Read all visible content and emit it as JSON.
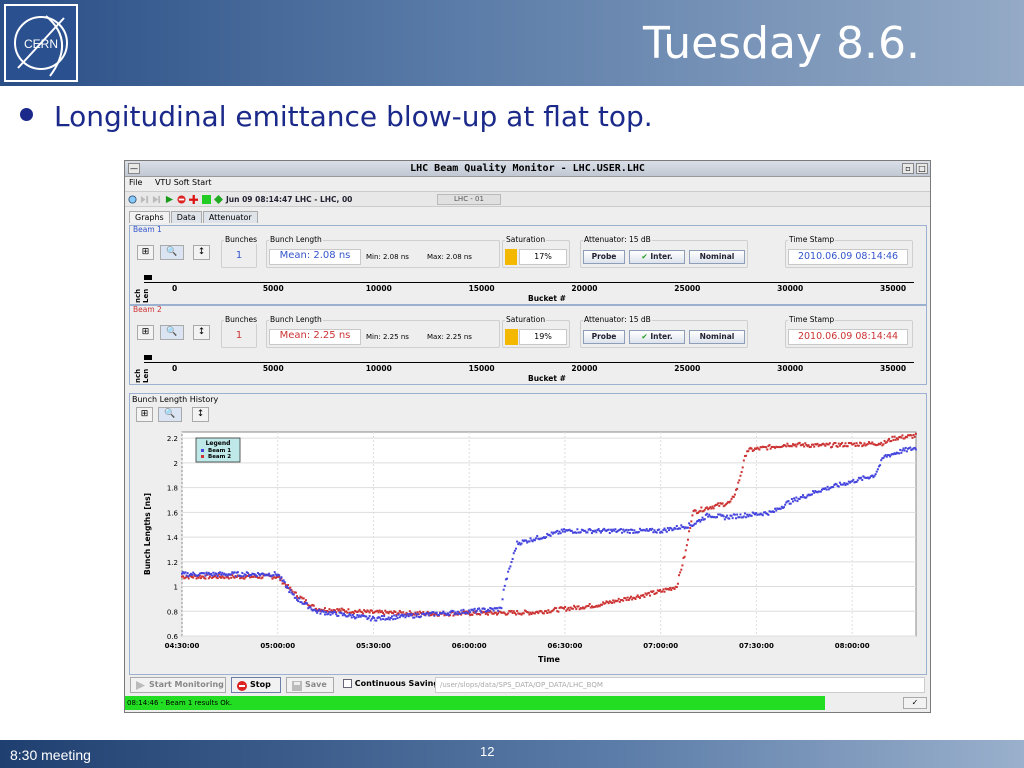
{
  "slide": {
    "title": "Tuesday 8.6.",
    "bullet": "Longitudinal emittance blow-up at flat top.",
    "footer_left": "8:30 meeting",
    "page_number": "12",
    "logo_text": "CERN"
  },
  "window": {
    "title": "LHC Beam Quality Monitor - LHC.USER.LHC",
    "menu": [
      "File",
      "VTU Soft Start"
    ],
    "toolbar_status": "Jun 09 08:14:47  LHC - LHC, 00",
    "toolbar_box": "LHC - 01",
    "tabs": [
      "Graphs",
      "Data",
      "Attenuator"
    ]
  },
  "beam1": {
    "title": "Beam 1",
    "color": "#3355cc",
    "bunches_label": "Bunches",
    "bunches": "1",
    "bunch_length_label": "Bunch Length",
    "mean": "Mean: 2.08 ns",
    "min": "Min: 2.08 ns",
    "max": "Max: 2.08 ns",
    "saturation_label": "Saturation",
    "saturation_value": "17%",
    "saturation_frac": 0.17,
    "attenuator_label": "Attenuator: 15 dB",
    "btn_probe": "Probe",
    "btn_inter": "Inter.",
    "btn_nominal": "Nominal",
    "timestamp_label": "Time Stamp",
    "timestamp": "2010.06.09 08:14:46",
    "ylabel": "nch Len",
    "xlabel": "Bucket #",
    "ticks": [
      "0",
      "5000",
      "10000",
      "15000",
      "20000",
      "25000",
      "30000",
      "35000"
    ]
  },
  "beam2": {
    "title": "Beam 2",
    "color": "#cc3333",
    "bunches_label": "Bunches",
    "bunches": "1",
    "bunch_length_label": "Bunch Length",
    "mean": "Mean: 2.25 ns",
    "min": "Min: 2.25 ns",
    "max": "Max: 2.25 ns",
    "saturation_label": "Saturation",
    "saturation_value": "19%",
    "saturation_frac": 0.19,
    "attenuator_label": "Attenuator: 15 dB",
    "btn_probe": "Probe",
    "btn_inter": "Inter.",
    "btn_nominal": "Nominal",
    "timestamp_label": "Time Stamp",
    "timestamp": "2010.06.09 08:14:44",
    "ylabel": "nch Len",
    "xlabel": "Bucket #",
    "ticks": [
      "0",
      "5000",
      "10000",
      "15000",
      "20000",
      "25000",
      "30000",
      "35000"
    ]
  },
  "history": {
    "title": "Bunch Length History",
    "legend_title": "Legend",
    "legend": [
      "Beam 1",
      "Beam 2"
    ]
  },
  "chart_data": {
    "type": "scatter",
    "title": "",
    "xlabel": "Time",
    "ylabel": "Bunch Lengths [ns]",
    "x_ticks": [
      "04:30:00",
      "05:00:00",
      "05:30:00",
      "06:00:00",
      "06:30:00",
      "07:00:00",
      "07:30:00",
      "08:00:00"
    ],
    "y_ticks": [
      "0.6",
      "0.8",
      "1",
      "1.2",
      "1.4",
      "1.6",
      "1.8",
      "2",
      "2.2"
    ],
    "ylim": [
      0.6,
      2.25
    ],
    "xlim_minutes": [
      270,
      500
    ],
    "grid": true,
    "legend_position": "top-left",
    "series": [
      {
        "name": "Beam 1",
        "color": "#4444dd",
        "x": [
          270,
          300,
          305,
          312,
          330,
          350,
          360,
          370,
          371,
          375,
          390,
          420,
          430,
          435,
          440,
          455,
          460,
          470,
          480,
          487,
          490,
          496,
          500
        ],
        "y": [
          1.1,
          1.1,
          0.92,
          0.8,
          0.74,
          0.78,
          0.8,
          0.82,
          1.0,
          1.35,
          1.45,
          1.45,
          1.5,
          1.58,
          1.56,
          1.6,
          1.68,
          1.78,
          1.85,
          1.9,
          2.05,
          2.1,
          2.12
        ]
      },
      {
        "name": "Beam 2",
        "color": "#cc3333",
        "x": [
          270,
          300,
          305,
          312,
          330,
          350,
          380,
          400,
          420,
          425,
          428,
          430,
          435,
          442,
          444,
          447,
          460,
          470,
          490,
          493,
          500
        ],
        "y": [
          1.08,
          1.08,
          0.95,
          0.82,
          0.79,
          0.78,
          0.79,
          0.85,
          0.96,
          1.0,
          1.3,
          1.6,
          1.64,
          1.68,
          1.8,
          2.1,
          2.15,
          2.14,
          2.16,
          2.2,
          2.22
        ]
      }
    ]
  },
  "bottom": {
    "start_monitoring": "Start Monitoring",
    "stop": "Stop",
    "save": "Save",
    "continuous_saving": "Continuous Saving",
    "path": "/user/slops/data/SPS_DATA/OP_DATA/LHC_BQM",
    "status": "08:14:46 - Beam 1 results Ok."
  }
}
